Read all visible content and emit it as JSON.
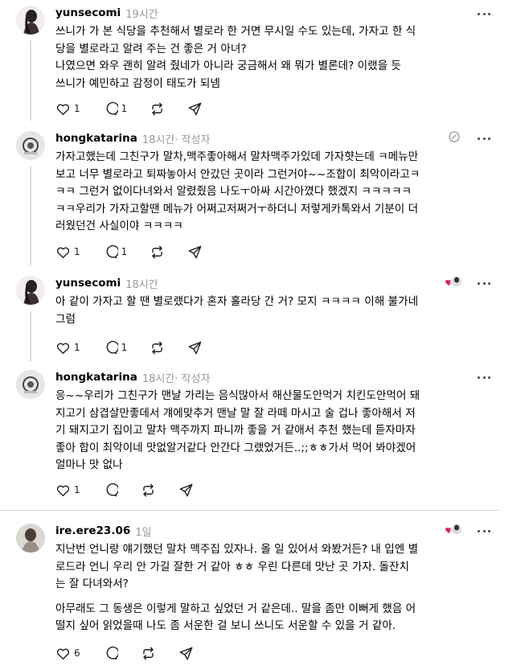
{
  "posts": [
    {
      "username": "yunsecomi",
      "time": "19시간",
      "author_tag": "",
      "paragraphs": [
        [
          "쓰니가 가 본 식당을 추천해서 별로라 한 거면 무시일 수도 있는데, 가자고 한 식",
          "당을 별로라고 알려 주는 건 좋은 거 아녀?",
          "나였으면 와우 괜히 알려 줬네가 아니라 궁금해서 왜 뭐가 별론데? 이랬을 듯",
          "쓰니가 예민하고 감정이 태도가 되넴"
        ]
      ],
      "likes": "1",
      "replies": "1"
    },
    {
      "username": "hongkatarina",
      "time": "18시간",
      "author_tag": " · 작성자",
      "paragraphs": [
        [
          "가자고했는데 그친구가 말차,맥주좋아해서 말차맥주가있데 가자햣는데 ㅋ메뉴만",
          "보고 너무 별로라고 퇴짜놓아서 안갔던 곳이라 그런거야~~조합이 최악이라고ㅋ",
          "ㅋㅋ 그런거 없이다녀와서 알렸줬음 나도ㅜ아싸 시간아꼈다 했겠지 ㅋㅋㅋㅋㅋ",
          "ㅋㅋ우리가 가자고할땐 메뉴가 어쩌고저쩌거ㅜ하더니 저렇게카톡와서 기분이 더",
          "러웠던건 사실이야 ㅋㅋㅋㅋ"
        ]
      ],
      "likes": "1",
      "replies": "1"
    },
    {
      "username": "yunsecomi",
      "time": "18시간",
      "author_tag": "",
      "paragraphs": [
        [
          "아 같이 가자고 할 땐 별로랬다가 혼자 홀라당 간 거? 모지 ㅋㅋㅋㅋ 이해 불가네",
          "그럼"
        ]
      ],
      "likes": "1",
      "replies": "1"
    },
    {
      "username": "hongkatarina",
      "time": "18시간",
      "author_tag": " · 작성자",
      "paragraphs": [
        [
          "응~~우리가 그친구가 맨날 가리는 음식많아서 해산물도안먹거 치킨도안먹어 돼",
          "지고기 삼겹살만좋데서 걔에맞추거 맨날 말 잘 라떼 마시고 술 겁나 좋아해서 저",
          "기 돼지고기 집이고 말차 맥주까지 파니까 좋을 거 같애서 추천 했는데 듣자마자",
          "좋아 합이 최악이네 맛없알거같다 안간다 그랬었거든..;;ㅎㅎ가서 먹어 봐야겠어",
          "얼마나 맛 없나"
        ]
      ],
      "likes": "1",
      "replies": ""
    },
    {
      "username": "ire.ere23.06",
      "time": "1일",
      "author_tag": "",
      "paragraphs": [
        [
          "지난번 언니랑 얘기했던 말차 맥주집 있자나. 올 일 있어서 와봤거든? 내 입엔 별",
          "로드라 언니 우리 안 가길 잘한 거 같아 ㅎㅎ 우린 다른데 맛난 곳 가자. 돌잔치",
          "는 잘 다녀와서?"
        ],
        [
          "아무래도 그 동생은 이렇게 말하고 싶었던 거 같은데.. 말을 좀만 이뻐게 했음 어",
          "떨지 싶어 읽었을때 나도 좀 서운한 걸 보니 쓰니도 서운할 수 있을 거 같아."
        ]
      ],
      "likes": "6",
      "replies": ""
    }
  ],
  "icons": {
    "like": "heart-icon",
    "reply": "comment-icon",
    "repost": "repost-icon",
    "share": "share-icon",
    "more": "more-icon",
    "edit": "edit-icon",
    "liked_by_author": "liked-by-author-icon"
  },
  "colors": {
    "text": "#000000",
    "muted": "#999999",
    "like_heart": "#e0245e",
    "divider": "#d8d8d8"
  }
}
